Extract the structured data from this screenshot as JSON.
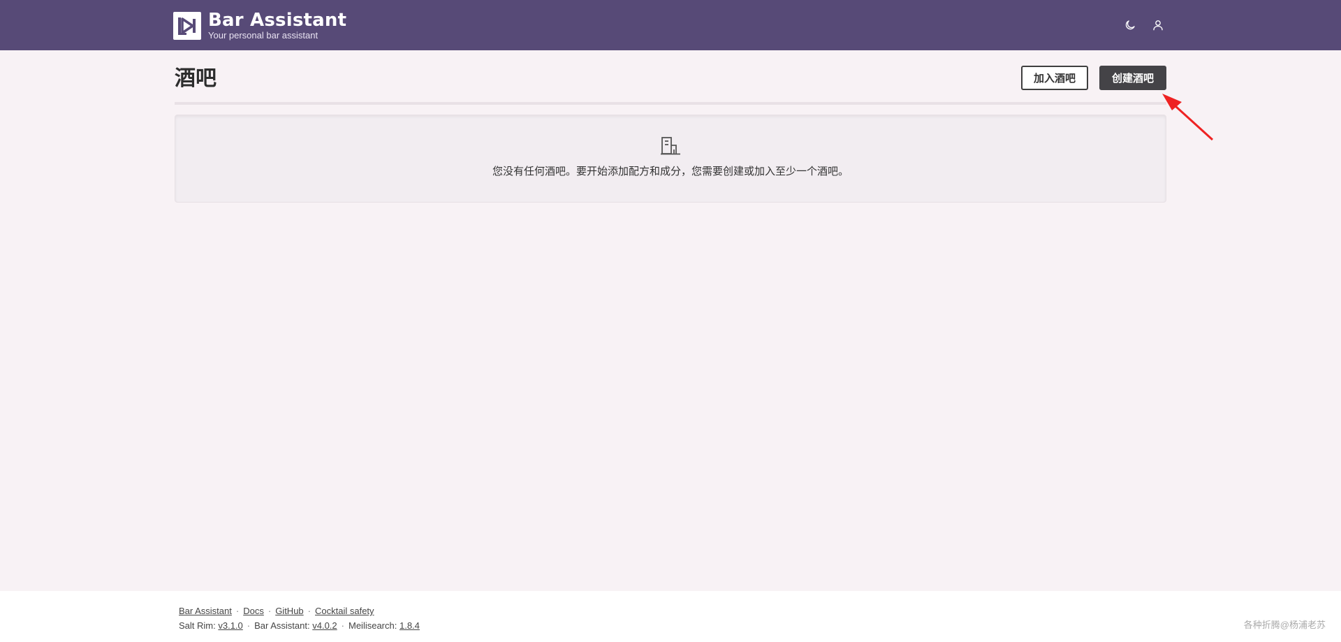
{
  "header": {
    "brand_title": "Bar Assistant",
    "brand_subtitle": "Your personal bar assistant",
    "icons": [
      "moon-icon",
      "user-icon"
    ],
    "background": "#574a77"
  },
  "page": {
    "title": "酒吧",
    "join_button": "加入酒吧",
    "create_button": "创建酒吧",
    "empty_icon": "building-icon",
    "empty_message": "您没有任何酒吧。要开始添加配方和成分，您需要创建或加入至少一个酒吧。"
  },
  "annotation": {
    "color": "#ee2222"
  },
  "footer": {
    "links": [
      "Bar Assistant",
      "Docs",
      "GitHub",
      "Cocktail safety"
    ],
    "salt_rim_label": "Salt Rim:",
    "salt_rim_version": "v3.1.0",
    "bar_assistant_label": "Bar Assistant:",
    "bar_assistant_version": "v4.0.2",
    "meilisearch_label": "Meilisearch:",
    "meilisearch_version": "1.8.4",
    "watermark": "各种折腾@杨浦老苏"
  }
}
